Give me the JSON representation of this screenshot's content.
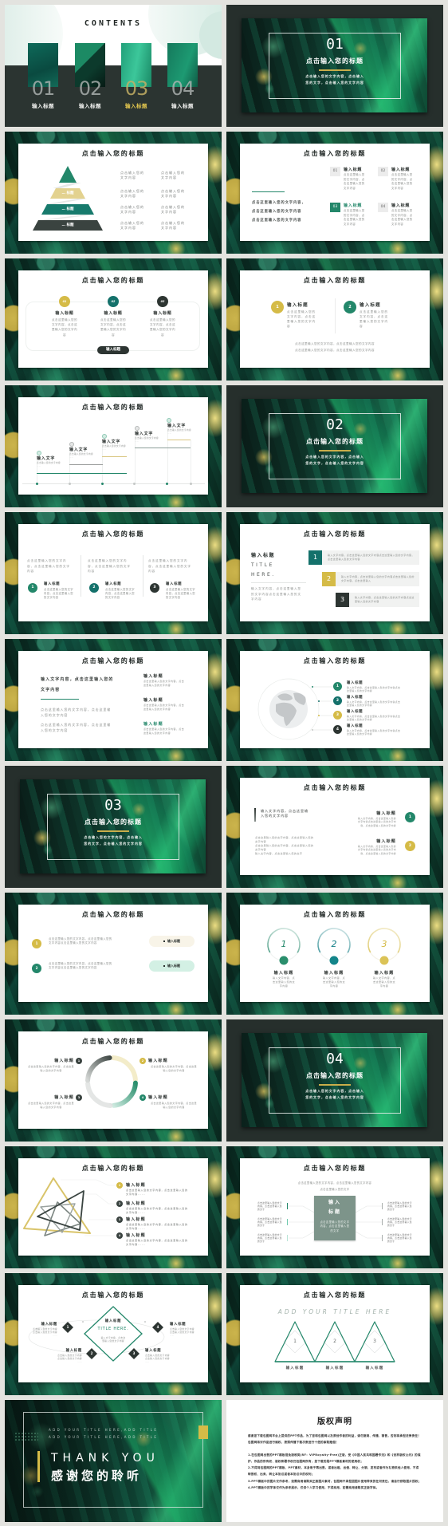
{
  "colors": {
    "page_bg": "#e3e3df",
    "dark": "#2d3532",
    "green": "#23876a",
    "teal": "#14716b",
    "gold": "#d5bb47"
  },
  "slides": {
    "s1": {
      "heading": "CONTENTS",
      "items": [
        {
          "num": "01",
          "label": "输入标题"
        },
        {
          "num": "02",
          "label": "输入标题"
        },
        {
          "num": "03",
          "label": "输入标题",
          "highlighted": true
        },
        {
          "num": "04",
          "label": "输入标题"
        }
      ]
    },
    "s2": {
      "num": "01",
      "title": "点击输入您的标题",
      "desc": [
        "点击输入您的文字内容，点击输入",
        "您的文字，点击输入您的文字内容"
      ]
    },
    "s3": {
      "title": "点击输入您的标题",
      "levels": [
        "… 标题",
        "… 标题",
        "… 标题"
      ],
      "texts": [
        "点击输入您的文字内容",
        "点击输入您的文字内容",
        "点击输入您的文字内容",
        "点击输入您的文字内容",
        "点击输入您的文字内容",
        "点击输入您的文字内容",
        "点击输入您的文字内容",
        "点击输入您的文字内容"
      ]
    },
    "s4": {
      "title": "点击输入您的标题",
      "intro": [
        "点击这里输入您的文字内容，",
        "点击这里输入您的文字内容",
        "点击这里输入您的文字内容"
      ],
      "items": [
        {
          "num": "01",
          "heading": "输入标题",
          "text": "点击这里输入您的文字内容，点击这里输入您的文字内容"
        },
        {
          "num": "02",
          "heading": "输入标题",
          "text": "点击这里输入您的文字内容，点击这里输入您的文字内容"
        },
        {
          "num": "03",
          "heading": "输入标题",
          "text": "点击这里输入您的文字内容，点击这里输入您的文字内容",
          "highlighted": true
        },
        {
          "num": "04",
          "heading": "输入标题",
          "text": "点击这里输入您的文字内容，点击这里输入您的文字内容"
        }
      ]
    },
    "s5": {
      "title": "点击输入您的标题",
      "items": [
        {
          "num": "01",
          "heading": "输入标题",
          "text": "点击这里输入您的文字内容，点击这里输入您的文字内容"
        },
        {
          "num": "02",
          "heading": "输入标题",
          "text": "点击这里输入您的文字内容，点击这里输入您的文字内容"
        },
        {
          "num": "03",
          "heading": "输入标题",
          "text": "点击这里输入您的文字内容，点击这里输入您的文字内容"
        }
      ],
      "button": "输入标题"
    },
    "s6": {
      "title": "点击输入您的标题",
      "items": [
        {
          "num": "1",
          "heading": "输入标题",
          "text": "点击这里输入您的文字内容，点击这里输入您的文字内容"
        },
        {
          "num": "2",
          "heading": "输入标题",
          "text": "点击这里输入您的文字内容，点击这里输入您的文字内容"
        }
      ],
      "footer": [
        "点击这里输入您的文字内容，点击这里输入您的文字内容",
        "点击这里输入您的文字内容，点击这里输入您的文字内容"
      ]
    },
    "s7": {
      "title": "点击输入您的标题",
      "steps": [
        {
          "heading": "输入文字",
          "text": "点击输入您的文字内容",
          "note": "……"
        },
        {
          "heading": "输入文字",
          "text": "点击输入您的文字内容",
          "note": "……"
        },
        {
          "heading": "输入文字",
          "text": "点击输入您的文字内容",
          "note": "……"
        },
        {
          "heading": "输入文字",
          "text": "点击输入您的文字内容",
          "note": "……"
        },
        {
          "heading": "输入文字",
          "text": "点击输入您的文字内容",
          "note": "……"
        }
      ]
    },
    "s8": {
      "num": "02",
      "title": "点击输入您的标题",
      "desc": [
        "点击输入您的文字内容，点击输入",
        "您的文字，点击输入您的文字内容"
      ]
    },
    "s9": {
      "title": "点击输入您的标题",
      "cols": [
        {
          "intro": "点击这里输入您的文字内容，点击这里输入您的文字内容",
          "num": "1",
          "heading": "输入标题",
          "text": "点击这里输入您的文字内容，点击这里输入您的文字内容"
        },
        {
          "intro": "点击这里输入您的文字内容，点击这里输入您的文字内容",
          "num": "2",
          "heading": "输入标题",
          "text": "点击这里输入您的文字内容，点击这里输入您的文字内容"
        },
        {
          "intro": "点击这里输入您的文字内容，点击这里输入您的文字内容",
          "num": "3",
          "heading": "输入标题",
          "text": "点击这里输入您的文字内容，点击这里输入您的文字内容"
        }
      ]
    },
    "s10": {
      "title": "点击输入您的标题",
      "heading": "输入标题",
      "en_line1": "TITLE",
      "en_line2": "HERE.",
      "text": "输入文字内容，点击这里输入您的文字内容点击这里输入您的文字内容",
      "rows": [
        {
          "num": "1",
          "text": "输入文字内容，点击这里输入您的文字内容点击这里输入您的文字内容，点击这里输入您的文字内容"
        },
        {
          "num": "2",
          "text": "输入文字内容，点击这里输入您的文字内容点击这里输入您的文字内容，点击这里输入"
        },
        {
          "num": "3",
          "text": "输入文字内容，点击这里输入您的文字内容点击这里输入您的文字内容"
        }
      ]
    },
    "s11": {
      "title": "点击输入您的标题",
      "lead": "输入文字内容，点击这里输入您的文字内容",
      "paras": [
        "点击这里输入您的文字内容，点击这里输入您的文字内容",
        "点击这里输入您的文字内容，点击这里输入您的文字内容"
      ],
      "items": [
        {
          "heading": "输入标题",
          "text": "点击这里输入您的文字内容，点击这里输入您的文字内容"
        },
        {
          "heading": "输入标题",
          "text": "点击这里输入您的文字内容，点击这里输入您的文字内容"
        },
        {
          "heading": "输入标题",
          "text": "点击这里输入您的文字内容，点击这里输入您的文字内容",
          "highlighted": true
        }
      ]
    },
    "s12": {
      "title": "点击输入您的标题",
      "items": [
        {
          "num": "1",
          "heading": "输入标题",
          "text": "输入文字内容，点击这里输入您的文字内容点击这里输入您的文字内容"
        },
        {
          "num": "2",
          "heading": "输入标题",
          "text": "输入文字内容，点击这里输入您的文字内容点击这里输入您的文字内容"
        },
        {
          "num": "3",
          "heading": "输入标题",
          "text": "输入文字内容，点击这里输入您的文字内容点击这里输入您的文字内容"
        },
        {
          "num": "4",
          "heading": "输入标题",
          "text": "输入文字内容，点击这里输入您的文字内容点击这里输入您的文字内容"
        }
      ]
    },
    "s13": {
      "num": "03",
      "title": "点击输入您的标题",
      "desc": [
        "点击输入您的文字内容，点击输入",
        "您的文字，点击输入您的文字内容"
      ]
    },
    "s14": {
      "title": "点击输入您的标题",
      "quote": "输入文字内容，点击这里输入您的文字内容",
      "body": [
        "点击这里输入您的文字内容，点击这里输入您的文字内容",
        "点击这里输入您的文字内容，点击这里输入您的文字内容",
        "输入文字内容，点击这里输入您的文字"
      ],
      "items": [
        {
          "num": "1",
          "heading": "输入标题",
          "text": "输入文字内容，点击这里输入您的文字内容点击这里输入您的文字内容，点击这里输入您的文字内容"
        },
        {
          "num": "2",
          "heading": "输入标题",
          "text": "输入文字内容，点击这里输入您的文字内容点击这里输入您的文字内容，点击这里输入您的文字内容"
        }
      ]
    },
    "s15": {
      "title": "点击输入您的标题",
      "rows": [
        {
          "num": "1",
          "text": "点击这里输入您的文字内容，点击这里输入您的文字内容点击这里输入您的文字内容",
          "tag": "输入标题"
        },
        {
          "num": "2",
          "text": "点击这里输入您的文字内容，点击这里输入您的文字内容点击这里输入您的文字内容",
          "tag": "输入标题"
        }
      ]
    },
    "s16": {
      "title": "点击输入您的标题",
      "rings": [
        {
          "num": "1",
          "heading": "输入标题",
          "text": "输入文字内容，点击这里输入您的文字内容"
        },
        {
          "num": "2",
          "heading": "输入标题",
          "text": "输入文字内容，点击这里输入您的文字内容"
        },
        {
          "num": "3",
          "heading": "输入标题",
          "text": "输入文字内容，点击这里输入您的文字内容"
        }
      ]
    },
    "s17": {
      "title": "点击输入您的标题",
      "items": [
        {
          "num": "1",
          "heading": "输入标题",
          "text": "点击这里输入您的文字内容，点击这里输入您的文字内容"
        },
        {
          "num": "2",
          "heading": "输入标题",
          "text": "点击这里输入您的文字内容，点击这里输入您的文字内容"
        },
        {
          "num": "3",
          "heading": "输入标题",
          "text": "点击这里输入您的文字内容，点击这里输入您的文字内容"
        },
        {
          "num": "4",
          "heading": "输入标题",
          "text": "点击这里输入您的文字内容，点击这里输入您的文字内容"
        }
      ]
    },
    "s18": {
      "num": "04",
      "title": "点击输入您的标题",
      "desc": [
        "点击输入您的文字内容，点击输入",
        "您的文字，点击输入您的文字内容"
      ]
    },
    "s19": {
      "title": "点击输入您的标题",
      "items": [
        {
          "num": "1",
          "heading": "输入标题",
          "text": "点击这里输入您的文字内容，点击这里输入您的文字内容......"
        },
        {
          "num": "2",
          "heading": "输入标题",
          "text": "点击这里输入您的文字内容，点击这里输入您的文字内容......"
        },
        {
          "num": "3",
          "heading": "输入标题",
          "text": "点击这里输入您的文字内容，点击这里输入您的文字内容......"
        },
        {
          "num": "4",
          "heading": "输入标题",
          "text": "点击这里输入您的文字内容，点击这里输入您的文字内容......"
        }
      ]
    },
    "s20": {
      "title": "点击输入您的标题",
      "intro": [
        "点击这里输入您的文字内容，点击这里输入您的文字内容",
        "点击这里输入您的文字"
      ],
      "center": {
        "line1": "输入",
        "line2": "标题",
        "text": "点击这里输入您的文字内容，点击这里输入您的文字"
      },
      "side_texts": [
        "点击这里输入您的文字内容，点击这里输入您的文字",
        "点击这里输入您的文字内容，点击这里输入您的文字",
        "点击这里输入您的文字内容，点击这里输入您的文字",
        "点击这里输入您的文字内容，点击这里输入您的文字",
        "点击这里输入您的文字内容，点击这里输入您的文字",
        "点击这里输入您的文字内容，点击这里输入您的文字"
      ]
    },
    "s21": {
      "title": "点击输入您的标题",
      "center": {
        "heading": "输入标题",
        "en": "TITLE HERE.",
        "text": "输入文字内容，点击这里输入您的文字内容"
      },
      "items": [
        {
          "num": "1",
          "heading": "输入标题",
          "lines": [
            "点击输入您的文字内容",
            "点击输入您的文字内容"
          ],
          "note": "……"
        },
        {
          "num": "2",
          "heading": "输入标题",
          "lines": [
            "点击输入您的文字内容",
            "点击输入您的文字内容"
          ],
          "note": "……"
        },
        {
          "num": "3",
          "heading": "输入标题",
          "lines": [
            "点击输入您的文字内容",
            "点击输入您的文字内容"
          ],
          "note": "……"
        },
        {
          "num": "4",
          "heading": "输入标题",
          "lines": [
            "点击输入您的文字内容",
            "点击输入您的文字内容"
          ],
          "note": "……"
        }
      ]
    },
    "s22": {
      "title": "点击输入您的标题",
      "subtitle": "ADD YOUR TITLE HERE",
      "items": [
        {
          "num": "1",
          "label": "输入标题"
        },
        {
          "num": "2",
          "label": "输入标题"
        },
        {
          "num": "3",
          "label": "输入标题"
        }
      ]
    },
    "s23": {
      "lines": [
        "ADD YOUR TITLE HERE,ADD TITLE",
        "ADD YOUR TITLE HERE,ADD TITLE"
      ],
      "en": "THANK YOU",
      "zh": "感谢您的聆听"
    },
    "s24": {
      "title": "版权声明",
      "paragraphs": [
        "感谢您下载包图网平台上提供的PPT作品，为了您和包图网以及原创作者的利益，请勿复制、传播、销售，否则将承担法律责任！包图网将对作品进行维权，按照传播下载次数进行十倍的索取赔偿！",
        "1.在包图网出售的PPT模板是免版税类(RF：VIPRoyalty-Free)正版，受《中国人民共和国著作法》和《世界版权公约》的保护，作品的所有权、版权和著作权归包图网所有，您下载的是PPT模板素材的使用权；",
        "2.不得将包图网的PPT模板、PPT素材，本身用于再出售，或者出租、出借、转让、分销、发布或者作为礼物供他人使用，不得转授权、出卖、转让本协议或者本协议中的权利；",
        "3.PPT模板中的图片仅作参考，如需商用请购买正版图片素材，包图网不承担因图片使用带来的任何责任，请自行获取图片授权；",
        "4.PPT模板中的字体仅作为参考展示，仅供个人学习使用，不得商用，如需商用请购买正版字体。"
      ]
    }
  }
}
